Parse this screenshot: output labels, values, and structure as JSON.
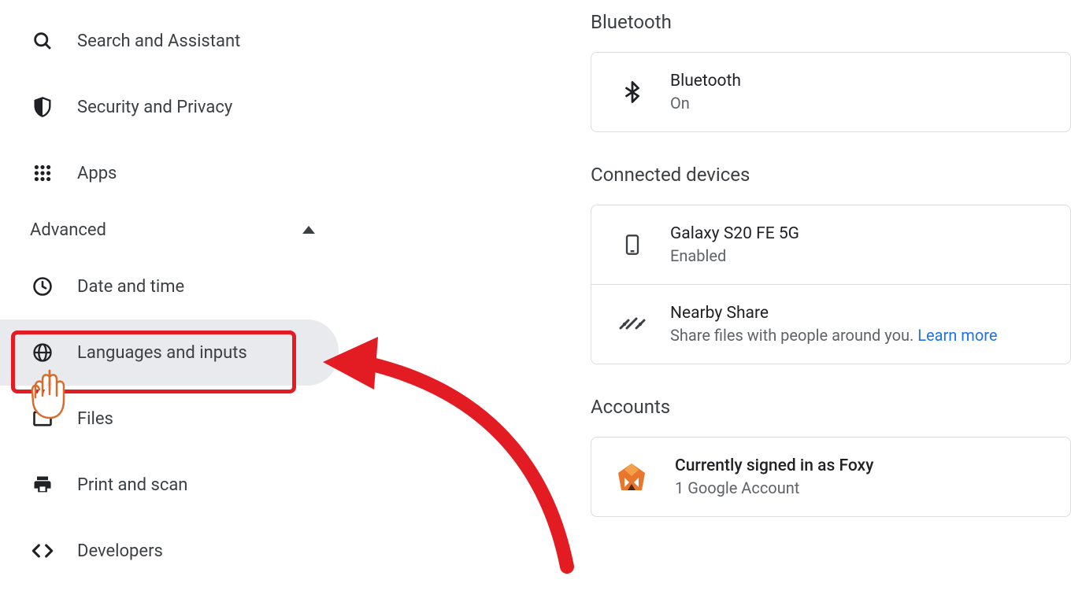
{
  "sidebar": {
    "items": {
      "search": {
        "label": "Search and Assistant"
      },
      "security": {
        "label": "Security and Privacy"
      },
      "apps": {
        "label": "Apps"
      }
    },
    "advanced": {
      "label": "Advanced",
      "expanded": true,
      "items": {
        "datetime": {
          "label": "Date and time"
        },
        "languages": {
          "label": "Languages and inputs"
        },
        "files": {
          "label": "Files"
        },
        "print": {
          "label": "Print and scan"
        },
        "dev": {
          "label": "Developers"
        }
      }
    }
  },
  "main": {
    "bluetooth": {
      "section_title": "Bluetooth",
      "row": {
        "title": "Bluetooth",
        "status": "On"
      }
    },
    "connected": {
      "section_title": "Connected devices",
      "device": {
        "title": "Galaxy S20 FE 5G",
        "status": "Enabled"
      },
      "nearby": {
        "title": "Nearby Share",
        "desc": "Share files with people around you.",
        "link": "Learn more"
      }
    },
    "accounts": {
      "section_title": "Accounts",
      "signed_in": {
        "title": "Currently signed in as Foxy",
        "sub": "1 Google Account"
      }
    }
  }
}
